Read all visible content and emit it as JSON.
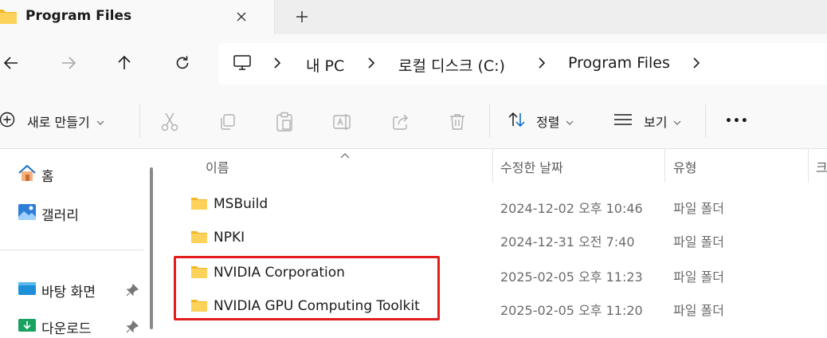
{
  "tab": {
    "title": "Program Files",
    "new_tab_symbol": "+"
  },
  "breadcrumb": {
    "items": [
      "내 PC",
      "로컬 디스크 (C:)",
      "Program Files"
    ]
  },
  "command_bar": {
    "new_label": "새로 만들기",
    "sort_label": "정렬",
    "view_label": "보기",
    "more_label": "•••"
  },
  "sidebar": {
    "items": [
      {
        "label": "홈",
        "icon": "home-icon"
      },
      {
        "label": "갤러리",
        "icon": "gallery-icon"
      },
      {
        "label": "바탕 화면",
        "icon": "desktop-icon"
      },
      {
        "label": "다운로드",
        "icon": "download-icon"
      }
    ]
  },
  "columns": {
    "name": "이름",
    "date": "수정한 날짜",
    "type": "유형",
    "size": "크"
  },
  "rows": [
    {
      "name": "MSBuild",
      "date": "2024-12-02 오후 10:46",
      "type": "파일 폴더"
    },
    {
      "name": "NPKI",
      "date": "2024-12-31 오전 7:40",
      "type": "파일 폴더"
    },
    {
      "name": "NVIDIA Corporation",
      "date": "2025-02-05 오후 11:23",
      "type": "파일 폴더"
    },
    {
      "name": "NVIDIA GPU Computing Toolkit",
      "date": "2025-02-05 오후 11:20",
      "type": "파일 폴더"
    }
  ],
  "colors": {
    "highlight": "#e11d1d",
    "folder": "#f6c344",
    "accent": "#0067c0"
  }
}
